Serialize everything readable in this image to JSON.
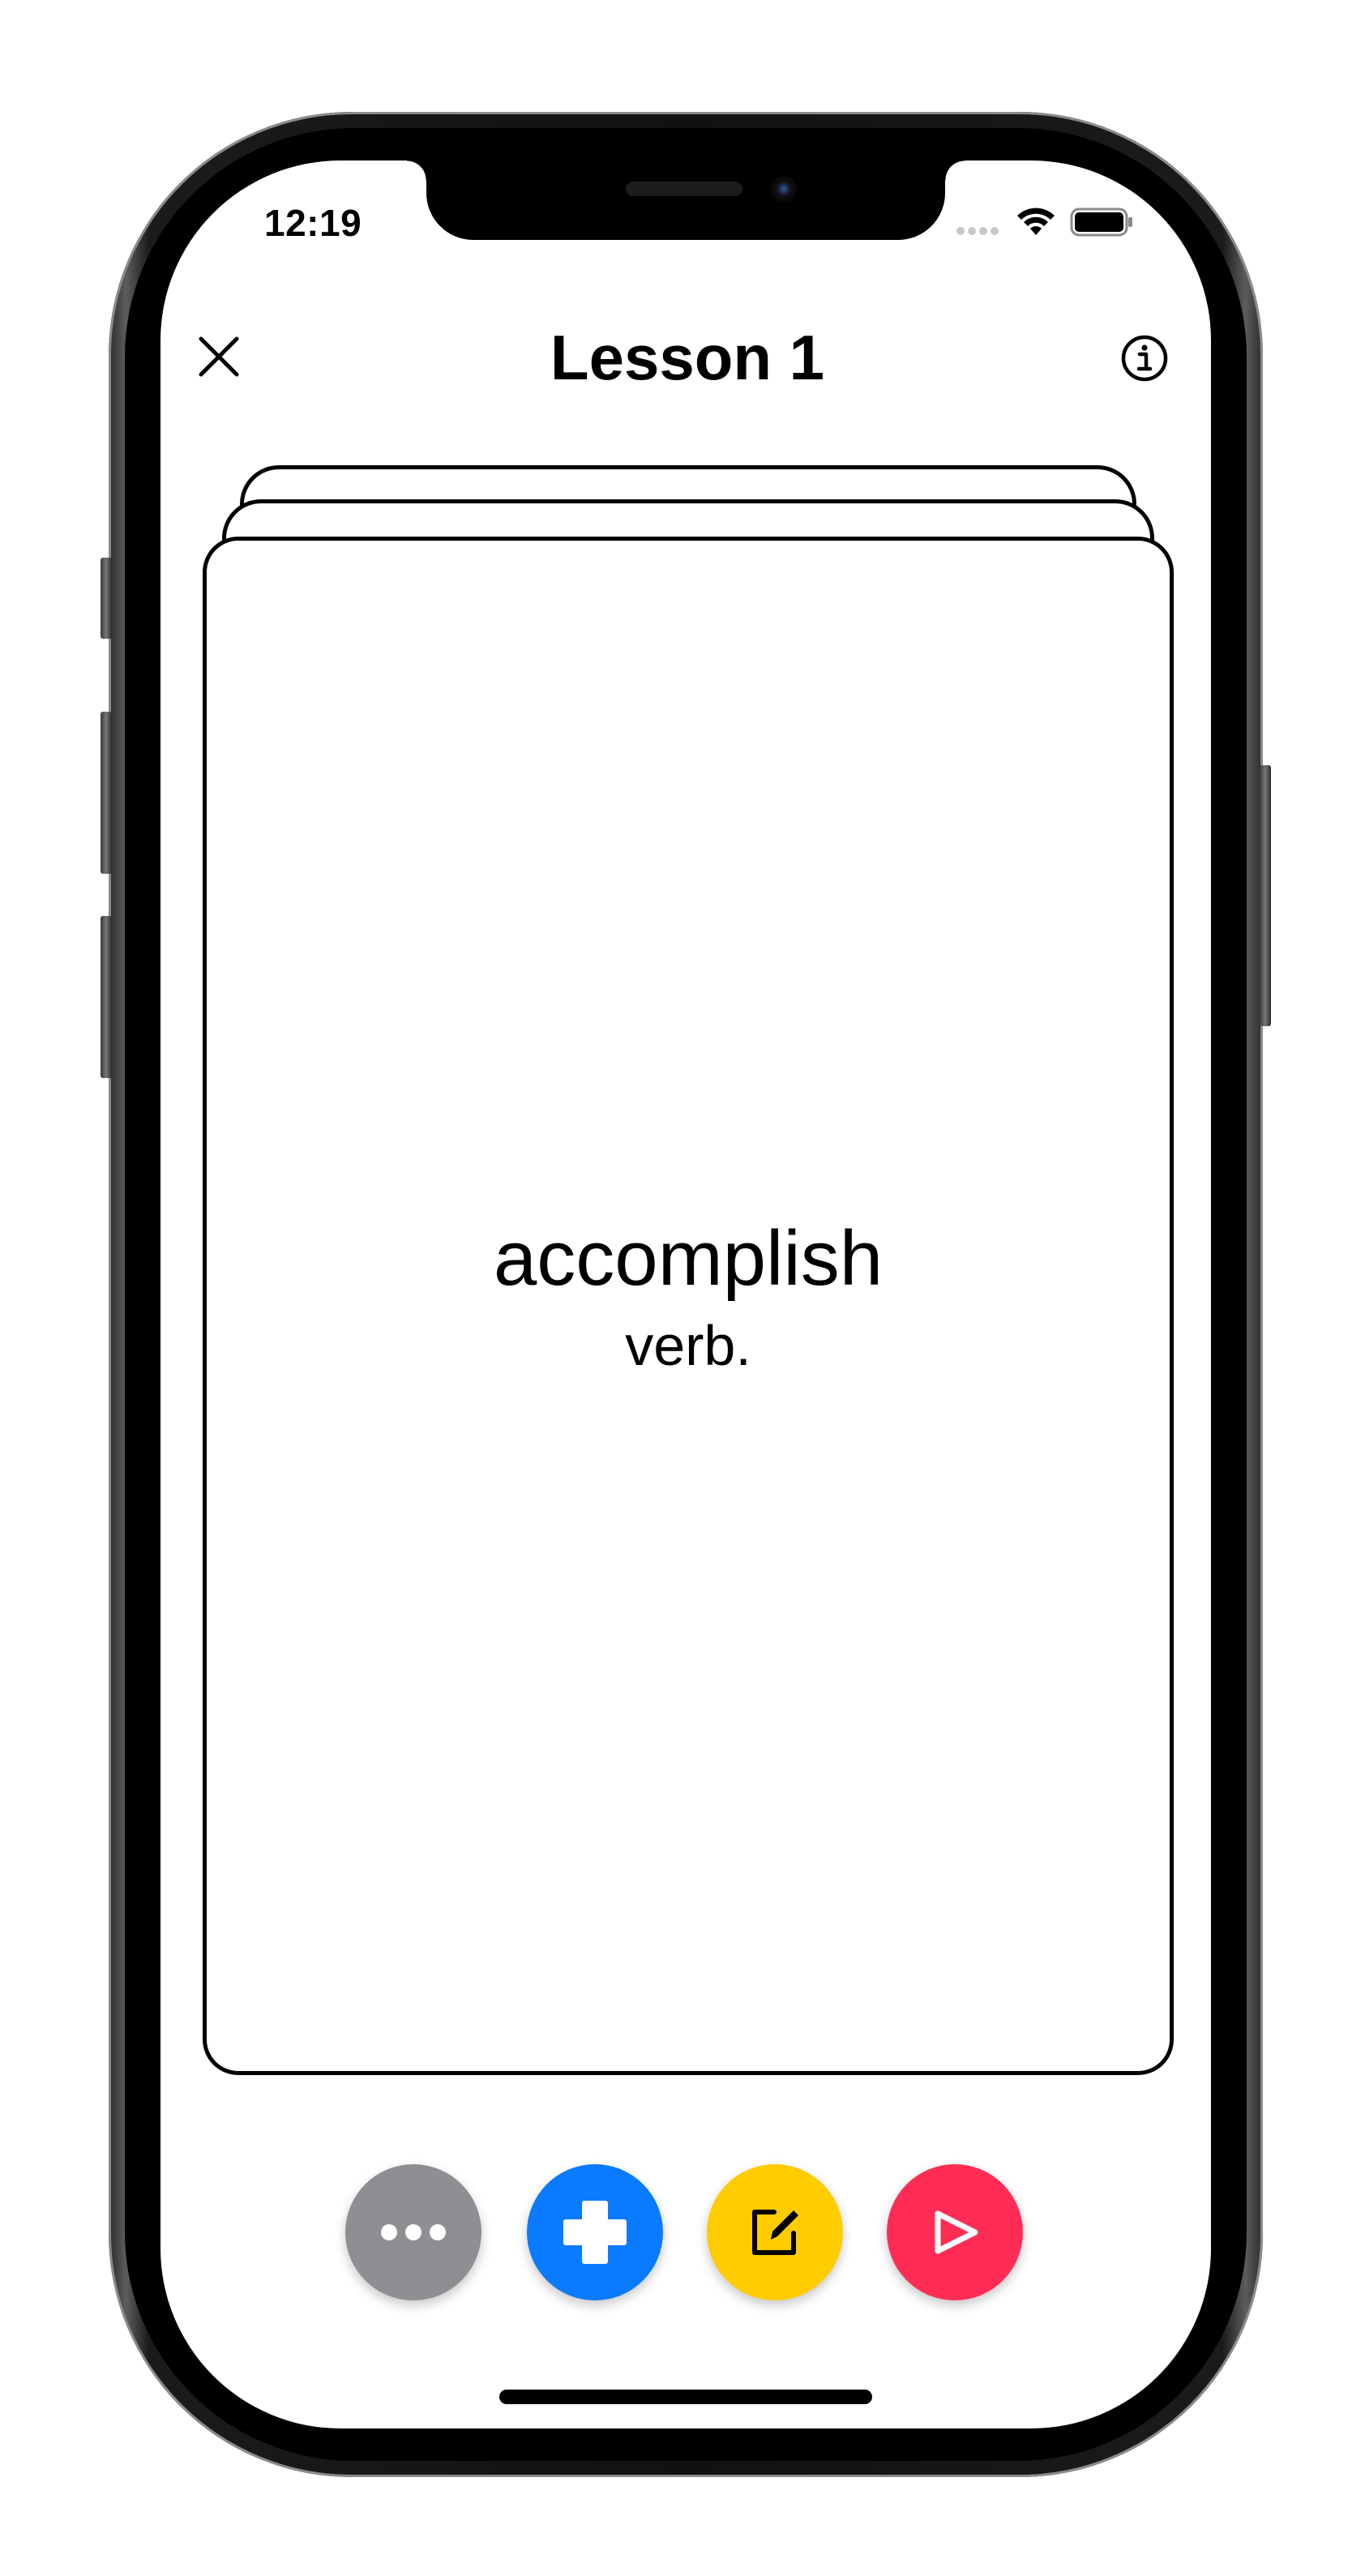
{
  "status_bar": {
    "time": "12:19"
  },
  "nav": {
    "title": "Lesson 1",
    "close_icon": "close-icon",
    "info_icon": "info-icon"
  },
  "card": {
    "word": "accomplish",
    "part_of_speech": "verb."
  },
  "actions": [
    {
      "name": "more",
      "icon": "ellipsis-icon",
      "color": "#8e8e93"
    },
    {
      "name": "add",
      "icon": "plus-icon",
      "color": "#0a7aff"
    },
    {
      "name": "edit",
      "icon": "edit-icon",
      "color": "#ffcc00"
    },
    {
      "name": "play",
      "icon": "play-icon",
      "color": "#ff2d55"
    }
  ]
}
